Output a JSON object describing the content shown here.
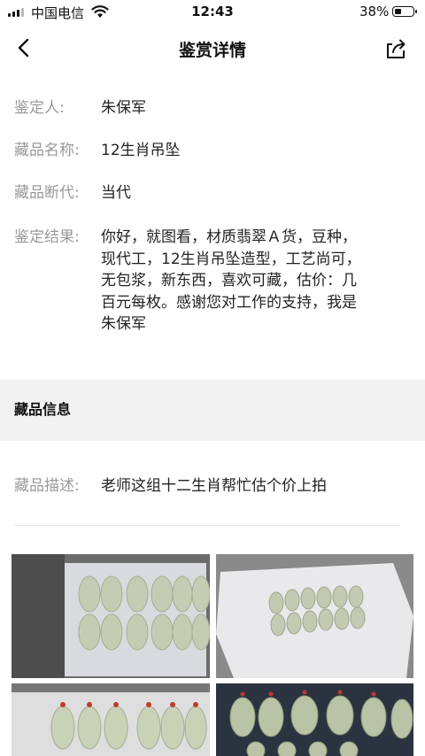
{
  "status_bar": {
    "carrier": "中国电信",
    "time": "12:43",
    "battery": "38%",
    "battery_level": 0.38
  },
  "nav": {
    "title": "鉴赏详情",
    "back_icon": "chevron-left-icon",
    "share_icon": "share-icon"
  },
  "details": {
    "appraiser": {
      "label": "鉴定人:",
      "value": "朱保军"
    },
    "item_name": {
      "label": "藏品名称:",
      "value": "12生肖吊坠"
    },
    "era": {
      "label": "藏品断代:",
      "value": "当代"
    },
    "result": {
      "label": "鉴定结果:",
      "lines": [
        "你好，就图看，材质翡翠Ａ货，豆种，",
        "现代工，12生肖吊坠造型，工艺尚可，",
        "无包浆，新东西，喜欢可藏，估价：几",
        "百元每枚。感谢您对工作的支持，我是",
        "朱保军"
      ]
    }
  },
  "section": {
    "title": "藏品信息"
  },
  "description": {
    "label": "藏品描述:",
    "value": "老师这组十二生肖帮忙估个价上拍"
  },
  "photos": [
    {
      "name": "jade-pendants-photo-1"
    },
    {
      "name": "jade-pendants-photo-2"
    },
    {
      "name": "jade-pendants-photo-3"
    },
    {
      "name": "jade-pendants-photo-4"
    }
  ]
}
